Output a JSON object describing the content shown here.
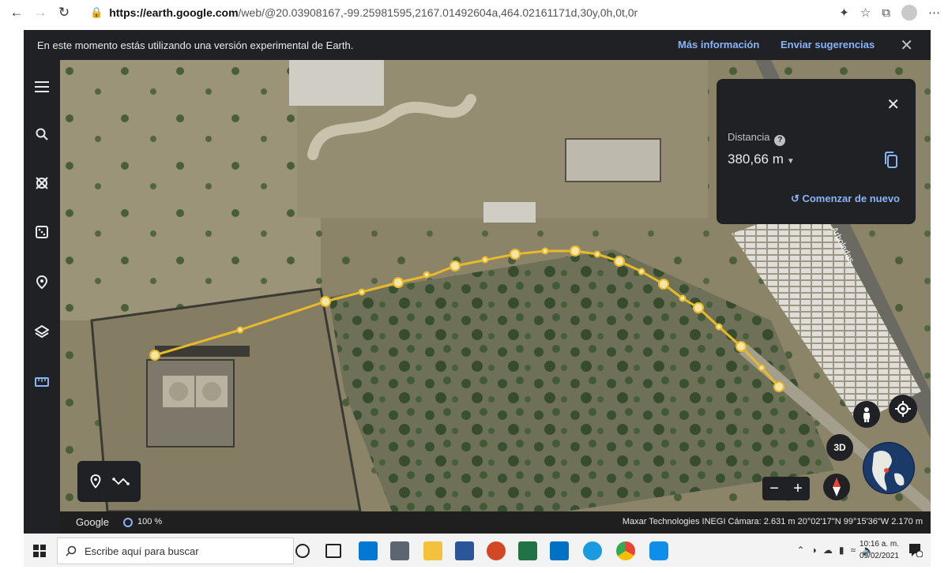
{
  "browser": {
    "url_host": "https://earth.google.com",
    "url_rest": "/web/@20.03908167,-99.25981595,2167.01492604a,464.02161171d,30y,0h,0t,0r",
    "icons": [
      "back-icon",
      "forward-icon",
      "refresh-icon",
      "lock-icon",
      "read-aloud-icon",
      "favorites-icon",
      "collections-icon",
      "profile-icon",
      "more-icon"
    ]
  },
  "banner": {
    "text": "En este momento estás utilizando una versión experimental de Earth.",
    "more_info": "Más información",
    "feedback": "Enviar sugerencias"
  },
  "sidebar": {
    "icons": [
      "menu-icon",
      "search-icon",
      "voyager-icon",
      "feeling-lucky-icon",
      "projects-icon",
      "map-style-icon",
      "measure-icon"
    ],
    "active": "measure-icon"
  },
  "measure_panel": {
    "label": "Distancia",
    "value": "380,66 m",
    "restart": "Comenzar de nuevo"
  },
  "map": {
    "road_label": "Arboledas",
    "controls": {
      "btn_3d": "3D",
      "zoom_out": "−",
      "zoom_in": "+"
    },
    "accent_color": "#f2c318",
    "path_color": "#e8b92a"
  },
  "footer": {
    "brand": "Google",
    "percent": "100 %",
    "attribution": "Maxar Technologies  INEGI    Cámara: 2.631 m   20°02'17\"N 99°15'36\"W   2.170 m"
  },
  "taskbar": {
    "search_placeholder": "Escribe aquí para buscar",
    "time": "10:16 a. m.",
    "date": "09/02/2021",
    "apps": [
      "cortana-icon",
      "task-view-icon",
      "store-icon",
      "calculator-icon",
      "file-explorer-icon",
      "word-icon",
      "powerpoint-icon",
      "excel-icon",
      "outlook-icon",
      "edge-icon",
      "chrome-icon",
      "teamviewer-icon"
    ]
  }
}
